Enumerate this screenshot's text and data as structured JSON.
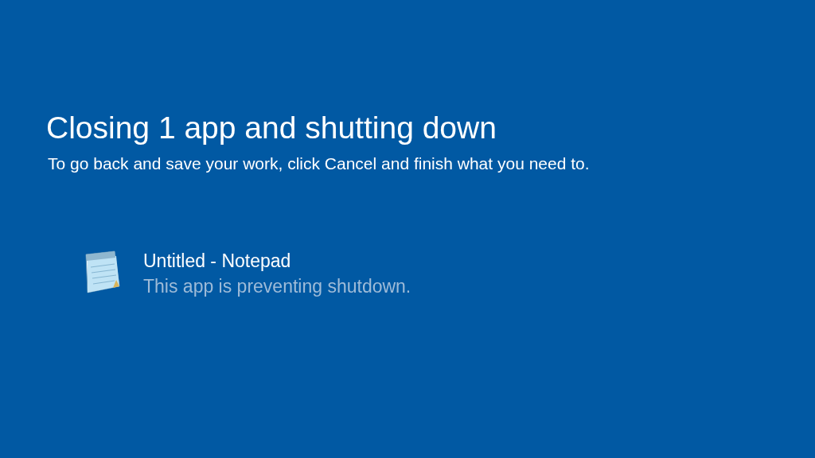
{
  "title": "Closing 1 app and shutting down",
  "subtitle": "To go back and save your work, click Cancel and finish what you need to.",
  "apps": [
    {
      "name": "Untitled - Notepad",
      "status": "This app is preventing shutdown."
    }
  ]
}
